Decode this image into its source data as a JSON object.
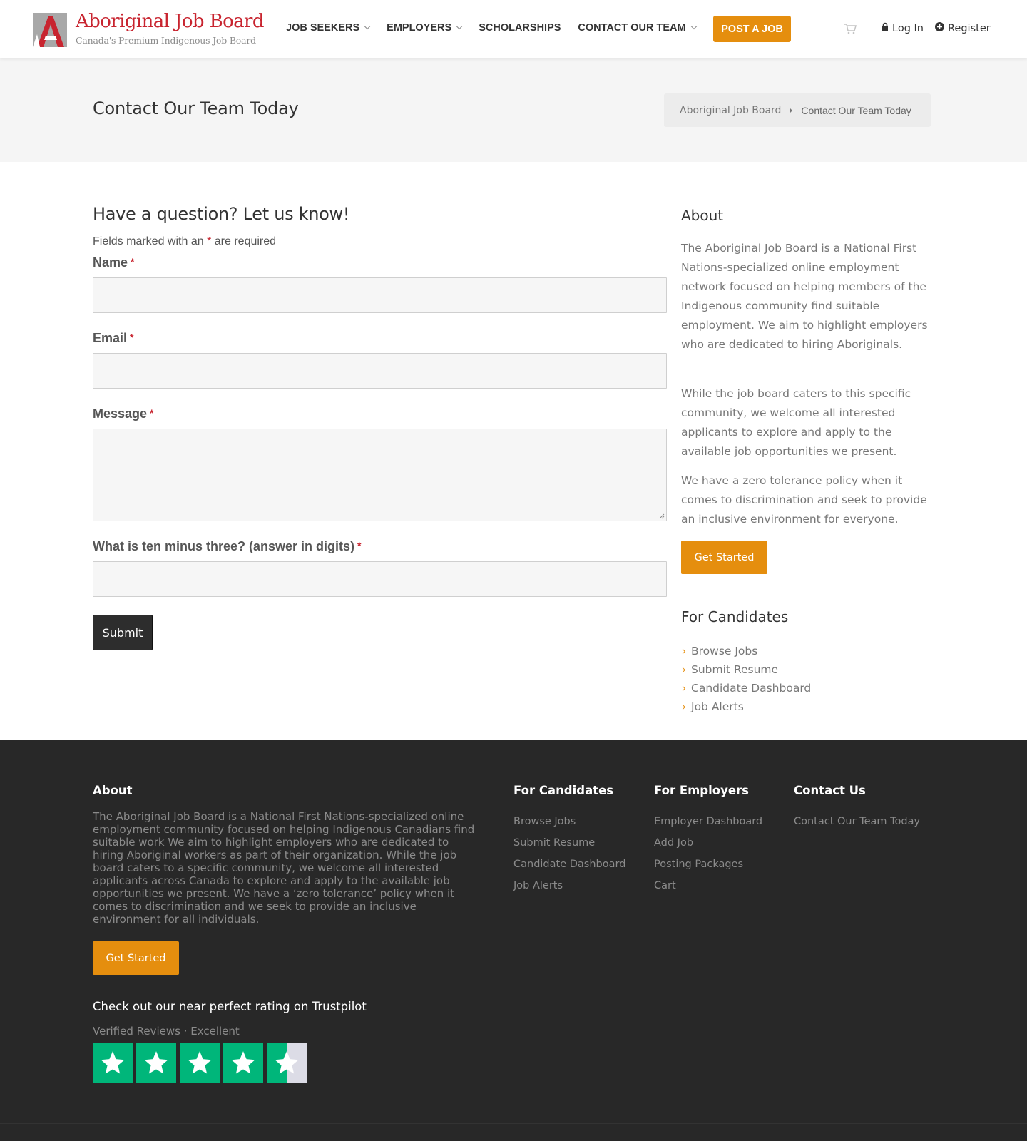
{
  "header": {
    "logo_title": "Aboriginal Job Board",
    "logo_subtitle": "Canada's Premium Indigenous Job Board",
    "nav": [
      {
        "label": "JOB SEEKERS",
        "has_dropdown": true
      },
      {
        "label": "EMPLOYERS",
        "has_dropdown": true
      },
      {
        "label": "SCHOLARSHIPS",
        "has_dropdown": false
      },
      {
        "label": "CONTACT OUR TEAM",
        "has_dropdown": true
      }
    ],
    "post_job_label": "POST A JOB",
    "login_label": "Log In",
    "register_label": "Register",
    "icons": {
      "cart": "cart-icon",
      "login": "lock-icon",
      "register": "plus-circle-icon"
    }
  },
  "title_band": {
    "page_title": "Contact Our Team Today",
    "breadcrumb": [
      "Aboriginal Job Board",
      "Contact Our Team Today"
    ]
  },
  "form": {
    "heading": "Have a question? Let us know!",
    "note_before": "Fields marked with an",
    "note_star": "*",
    "note_after": "are required",
    "fields": [
      {
        "label": "Name",
        "value": "",
        "placeholder": ""
      },
      {
        "label": "Email",
        "value": "",
        "placeholder": ""
      },
      {
        "label": "Message",
        "value": "",
        "placeholder": ""
      },
      {
        "label": "What is ten minus three? (answer in digits)",
        "value": "",
        "placeholder": ""
      }
    ],
    "required_mark": "*",
    "submit_label": "Submit"
  },
  "sidebar": {
    "about_heading": "About",
    "about_paragraphs": [
      "The Aboriginal Job Board is a National First Nations-specialized online employment network focused on helping members of the Indigenous community find suitable employment. We aim to highlight employers who are dedicated to hiring Aboriginals.",
      "While the job board caters to this specific community, we welcome all interested applicants to explore and apply to the available job opportunities we present.",
      "We have a zero tolerance policy when it comes to discrimination and seek to provide an inclusive environment for everyone."
    ],
    "get_started_label": "Get Started",
    "candidates_heading": "For Candidates",
    "candidate_links": [
      "Browse Jobs",
      "Submit Resume",
      "Candidate Dashboard",
      "Job Alerts"
    ]
  },
  "footer": {
    "about_heading": "About",
    "about_text": "The Aboriginal Job Board is a National First Nations-specialized online employment community focused on helping Indigenous Canadians find suitable work We aim to highlight employers who are dedicated to hiring Aboriginal workers as part of their organization. While the job board caters to a specific community, we welcome all interested applicants across Canada to explore and apply to the available job opportunities we present. We have a ‘zero tolerance’ policy when it comes to discrimination and we seek to provide an inclusive environment for all individuals.",
    "get_started_label": "Get Started",
    "trust_title": "Check out our near perfect rating on Trustpilot",
    "trust_sub": "Verified Reviews · Excellent",
    "trust_rating": 4.5,
    "trust_max": 5,
    "candidates_heading": "For Candidates",
    "candidate_links": [
      "Browse Jobs",
      "Submit Resume",
      "Candidate Dashboard",
      "Job Alerts"
    ],
    "employers_heading": "For Employers",
    "employer_links": [
      "Employer Dashboard",
      "Add Job",
      "Posting Packages",
      "Cart"
    ],
    "contact_heading": "Contact Us",
    "contact_links": [
      "Contact Our Team Today"
    ]
  },
  "colors": {
    "accent": "#e58e0e",
    "brand_red": "#c8242f",
    "footer_bg": "#282828",
    "trustpilot_green": "#00b67a"
  }
}
